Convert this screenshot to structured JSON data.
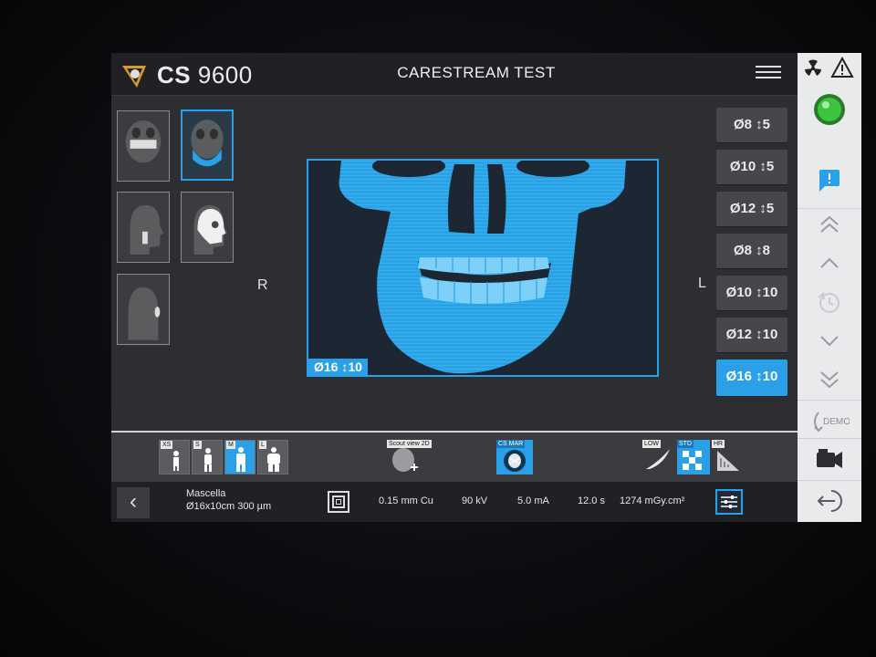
{
  "header": {
    "brand_bold": "CS",
    "brand_num": "9600",
    "title": "CARESTREAM TEST"
  },
  "orientation": {
    "left": "R",
    "right": "L"
  },
  "preview": {
    "fov_label": "Ø16 ↕10"
  },
  "fov_options": [
    {
      "label": "Ø8 ↕5",
      "selected": false
    },
    {
      "label": "Ø10 ↕5",
      "selected": false
    },
    {
      "label": "Ø12 ↕5",
      "selected": false
    },
    {
      "label": "Ø8 ↕8",
      "selected": false
    },
    {
      "label": "Ø10 ↕10",
      "selected": false
    },
    {
      "label": "Ø12 ↕10",
      "selected": false
    },
    {
      "label": "Ø16 ↕10",
      "selected": true
    }
  ],
  "patient_sizes": [
    {
      "label": "XS",
      "selected": false
    },
    {
      "label": "S",
      "selected": false
    },
    {
      "label": "M",
      "selected": true
    },
    {
      "label": "L",
      "selected": false
    }
  ],
  "tools": {
    "scout": "Scout view 2D",
    "csmar": "CS MAR",
    "low": "LOW",
    "std": "STD",
    "hr": "HR"
  },
  "sidebar": {
    "demo": "DEMO"
  },
  "info": {
    "region": "Mascella",
    "fov": "Ø16x10cm 300 µm",
    "filter": "0.15 mm Cu",
    "kv": "90 kV",
    "ma": "5.0 mA",
    "time": "12.0 s",
    "dose": "1274 mGy.cm²"
  },
  "colors": {
    "accent": "#2aa0e8",
    "status_ok": "#3cc53c"
  }
}
